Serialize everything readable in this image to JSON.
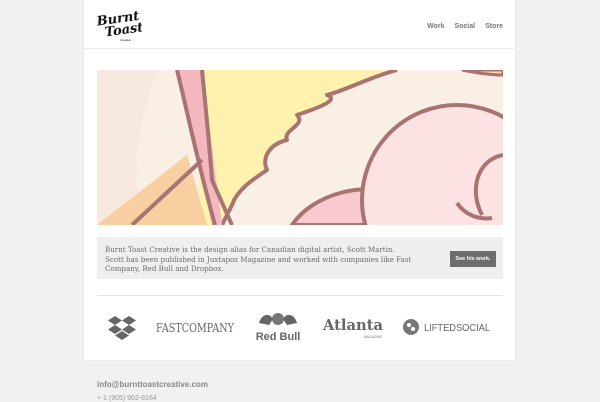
{
  "brand": {
    "logo_text_line1": "Burnt",
    "logo_text_line2": "Toast",
    "logo_text_line3": "Creative"
  },
  "nav": {
    "items": [
      {
        "label": "Work"
      },
      {
        "label": "Social"
      },
      {
        "label": "Store"
      }
    ]
  },
  "intro": {
    "text": "Burnt Toast Creative is the design alias for Canadian digital artist, Scott Martin. Scott has been published in Juxtapoz Magazine and worked with companies like Fast Company, Red Bull and Dropbox.",
    "button_label": "See his work."
  },
  "client_logos": {
    "fastcompany": "FASTCOMPANY",
    "redbull": "Red Bull",
    "atlanta": "Atlanta",
    "atlanta_sub": "MAGAZINE",
    "lifted": "LIFTEDSOCIAL"
  },
  "footer": {
    "email": "info@burnttoastcreative.com",
    "phone": "+ 1 (905) 902-8164"
  },
  "colors": {
    "page_bg": "#f1f1f1",
    "card_bg": "#ffffff",
    "button_bg": "#6d6d6d",
    "nav_text": "#777777"
  }
}
